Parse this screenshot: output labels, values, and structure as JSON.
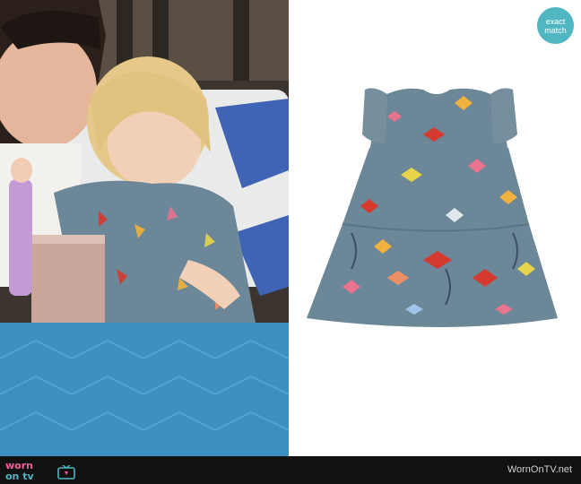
{
  "badge": {
    "line1": "exact",
    "line2": "match"
  },
  "footer": {
    "logo_top": "worn",
    "logo_bottom": "on tv",
    "site_name": "WornOnTV.net"
  },
  "colors": {
    "badge": "#4fb6c2",
    "logo_pink": "#f25e9a",
    "logo_teal": "#4fb6c2",
    "footer_bg": "#111111",
    "dress_base": "#6c8797"
  },
  "icons": [
    "tv-icon"
  ]
}
